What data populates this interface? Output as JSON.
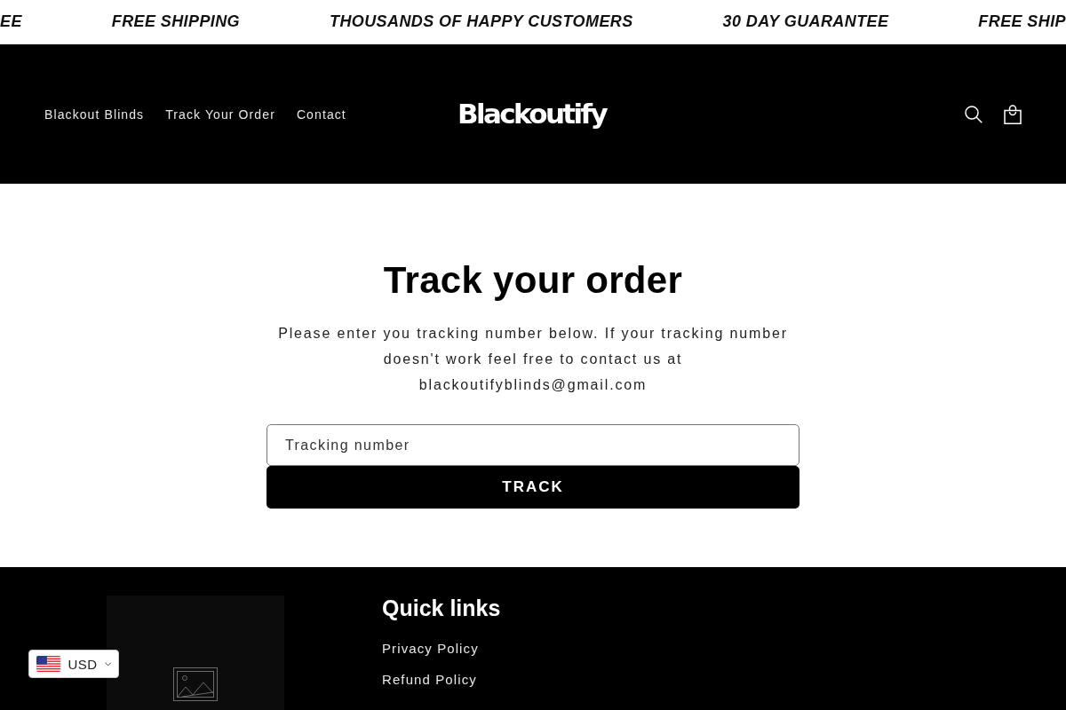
{
  "announcement_bar": {
    "items": [
      "EE",
      "FREE SHIPPING",
      "THOUSANDS OF HAPPY CUSTOMERS",
      "30 DAY GUARANTEE",
      "FREE SHIP"
    ]
  },
  "header": {
    "nav": [
      "Blackout Blinds",
      "Track Your Order",
      "Contact"
    ],
    "logo": "Blackoutify"
  },
  "main": {
    "title": "Track your order",
    "description": "Please enter you tracking number below. If your tracking number doesn't work feel free to contact us at blackoutifyblinds@gmail.com",
    "tracking_field": {
      "placeholder": "Tracking number"
    },
    "submit_button": "TRACK"
  },
  "footer": {
    "quick_links": {
      "title": "Quick links",
      "links": [
        "Privacy Policy",
        "Refund Policy"
      ]
    }
  },
  "currency_selector": {
    "value": "USD"
  }
}
